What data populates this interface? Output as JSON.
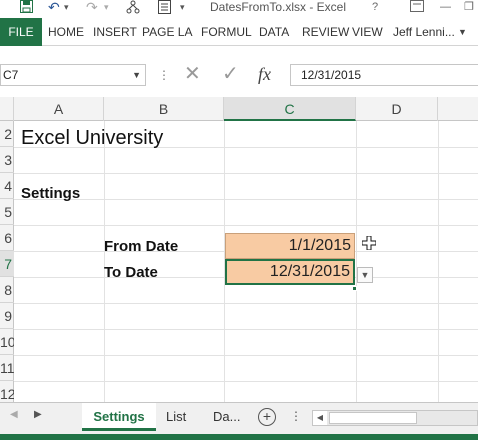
{
  "window": {
    "title": "DatesFromTo.xlsx - Excel",
    "help": "?",
    "minimize": "—",
    "restore": "❐"
  },
  "quick_access": {
    "save_icon": "save-icon",
    "undo": "↶",
    "undo_caret": "▾",
    "redo": "↷",
    "redo_caret": "▾"
  },
  "ribbon": {
    "file": "FILE",
    "tabs": [
      "HOME",
      "INSERT",
      "PAGE LA",
      "FORMUL",
      "DATA",
      "REVIEW",
      "VIEW"
    ],
    "user": "Jeff Lenni..."
  },
  "formula_bar": {
    "name_box": "C7",
    "cancel": "✕",
    "enter": "✓",
    "fx": "fx",
    "value": "12/31/2015"
  },
  "columns": [
    "A",
    "B",
    "C",
    "D"
  ],
  "rows": [
    "2",
    "3",
    "4",
    "5",
    "6",
    "7",
    "8",
    "9",
    "10",
    "11",
    "12"
  ],
  "active": {
    "column": "C",
    "row": "7"
  },
  "cells": {
    "title": "Excel University",
    "settings_heading": "Settings",
    "from_label": "From Date",
    "from_value": "1/1/2015",
    "to_label": "To Date",
    "to_value": "12/31/2015",
    "fill_color": "#f8cba3"
  },
  "sheet_tabs": {
    "tabs": [
      "Settings",
      "List",
      "Da..."
    ],
    "active": "Settings",
    "add": "+"
  },
  "colors": {
    "excel_green": "#217346"
  }
}
